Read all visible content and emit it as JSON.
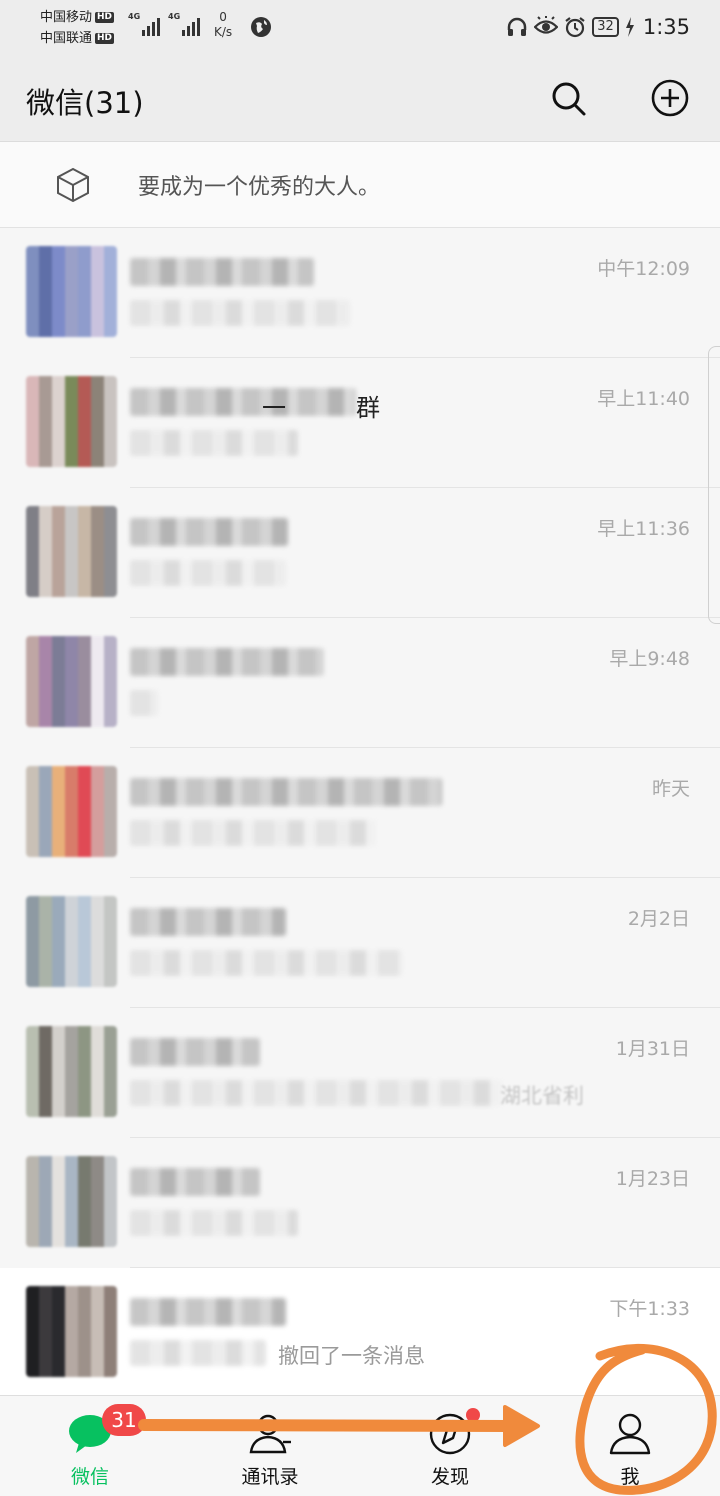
{
  "status_bar": {
    "carrier1": "中国移动",
    "carrier2": "中国联通",
    "hd": "HD",
    "net1": "4G",
    "net2": "4G",
    "speed_value": "0",
    "speed_unit": "K/s",
    "battery": "32",
    "time": "1:35"
  },
  "header": {
    "title": "微信(31)",
    "search_icon": "search-icon",
    "add_icon": "plus-circle-icon"
  },
  "status_prompt": {
    "icon": "cube-icon",
    "text": "要成为一个优秀的大人。"
  },
  "chats": [
    {
      "time": "中午12:09"
    },
    {
      "time": "早上11:40",
      "name_fragment": "一",
      "name_suffix": "群"
    },
    {
      "time": "早上11:36"
    },
    {
      "time": "早上9:48"
    },
    {
      "time": "昨天"
    },
    {
      "time": "2月2日"
    },
    {
      "time": "1月31日",
      "message_fragment": "湖北省利"
    },
    {
      "time": "1月23日"
    },
    {
      "time": "下午1:33",
      "message_fragment": "撤回了一条消息"
    }
  ],
  "bottom_nav": {
    "tabs": [
      {
        "label": "微信",
        "icon": "chat-bubble-icon",
        "badge": "31",
        "active": true
      },
      {
        "label": "通讯录",
        "icon": "contacts-icon"
      },
      {
        "label": "发现",
        "icon": "compass-icon"
      },
      {
        "label": "我",
        "icon": "person-icon"
      }
    ]
  },
  "colors": {
    "accent": "#07c160",
    "badge": "#f04848",
    "annotation": "#f08a3c",
    "background": "#ededed"
  }
}
